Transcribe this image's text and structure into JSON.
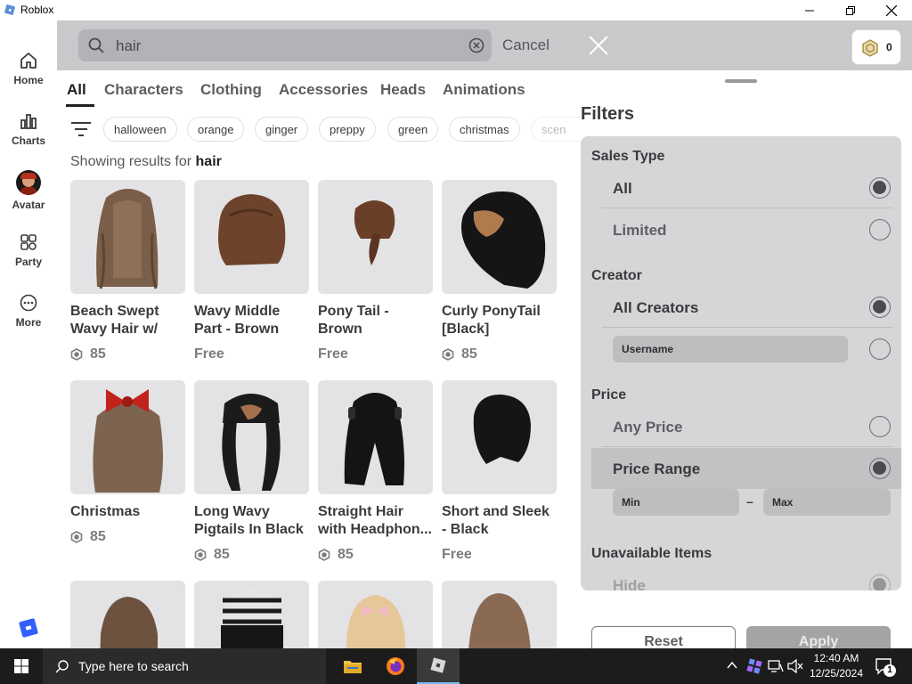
{
  "window": {
    "title": "Roblox"
  },
  "nav": {
    "items": [
      {
        "label": "Home",
        "icon": "home-icon"
      },
      {
        "label": "Charts",
        "icon": "charts-icon"
      },
      {
        "label": "Avatar",
        "icon": "avatar-icon"
      },
      {
        "label": "Party",
        "icon": "party-icon"
      },
      {
        "label": "More",
        "icon": "more-icon"
      }
    ]
  },
  "search": {
    "query": "hair",
    "cancel_label": "Cancel"
  },
  "robux": {
    "balance": "0"
  },
  "tabs": [
    "All",
    "Characters",
    "Clothing",
    "Accessories",
    "Heads",
    "Animations"
  ],
  "active_tab": "All",
  "chips": [
    "halloween",
    "orange",
    "ginger",
    "preppy",
    "green",
    "christmas",
    "scen"
  ],
  "results": {
    "prefix": "Showing results for ",
    "term": "hair",
    "items": [
      {
        "name": "Beach Swept Wavy Hair w/",
        "price": "85",
        "currency": "robux"
      },
      {
        "name": "Wavy Middle Part - Brown",
        "price": "Free",
        "currency": ""
      },
      {
        "name": "Pony Tail - Brown",
        "price": "Free",
        "currency": ""
      },
      {
        "name": "Curly PonyTail [Black]",
        "price": "85",
        "currency": "robux"
      },
      {
        "name": "Christmas",
        "price": "85",
        "currency": "robux"
      },
      {
        "name": "Long Wavy Pigtails In Black",
        "price": "85",
        "currency": "robux"
      },
      {
        "name": "Straight Hair with Headphon...",
        "price": "85",
        "currency": "robux"
      },
      {
        "name": "Short and Sleek - Black",
        "price": "Free",
        "currency": ""
      }
    ]
  },
  "filters": {
    "title": "Filters",
    "sales_type": {
      "title": "Sales Type",
      "options": [
        "All",
        "Limited"
      ],
      "selected": "All"
    },
    "creator": {
      "title": "Creator",
      "options": [
        "All Creators"
      ],
      "username_placeholder": "Username",
      "selected": "All Creators"
    },
    "price": {
      "title": "Price",
      "options": [
        "Any Price",
        "Price Range"
      ],
      "selected": "Price Range",
      "min_placeholder": "Min",
      "dash": "–",
      "max_placeholder": "Max"
    },
    "unavailable": {
      "title": "Unavailable Items",
      "options": [
        "Hide"
      ]
    },
    "reset_label": "Reset",
    "apply_label": "Apply"
  },
  "taskbar": {
    "search_placeholder": "Type here to search",
    "time": "12:40 AM",
    "date": "12/25/2024",
    "notification_count": "1"
  },
  "colors": {
    "accent": "#335fff",
    "panel": "#d6d6d8",
    "topbar": "#c9c9cc"
  }
}
